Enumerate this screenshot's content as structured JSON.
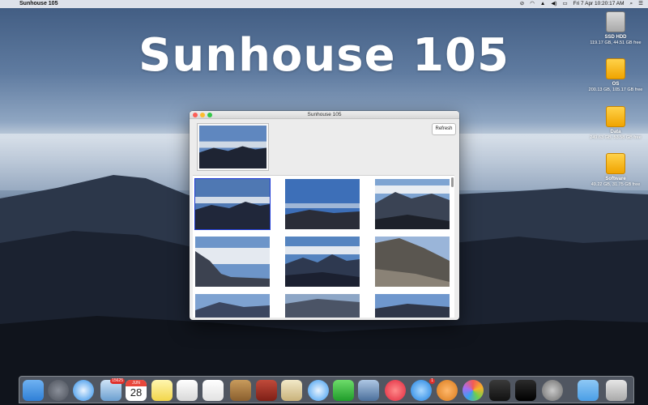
{
  "menubar": {
    "apple_glyph": "",
    "app_name": "Sunhouse 105",
    "date_time": "Fri 7 Apr  10:20:17 AM"
  },
  "desktop": {
    "big_title": "Sunhouse 105",
    "drives": [
      {
        "name": "SSD HDD",
        "info": "119.17 GB, 44.51 GB free",
        "kind": "hdd-icon"
      },
      {
        "name": "OS",
        "info": "200.13 GB, 105.17 GB free",
        "kind": "usb-drive-icon"
      },
      {
        "name": "Data",
        "info": "249.63 GB, 53.58 GB free",
        "kind": "usb-drive-icon"
      },
      {
        "name": "Software",
        "info": "49.22 GB, 31.75 GB free",
        "kind": "usb-drive-icon"
      }
    ]
  },
  "window": {
    "title": "Sunhouse 105",
    "refresh_label": "Refresh"
  },
  "dock": {
    "mail_badge": "15625",
    "calendar_month": "JUN",
    "calendar_day": "28",
    "appstore_badge": "1"
  }
}
